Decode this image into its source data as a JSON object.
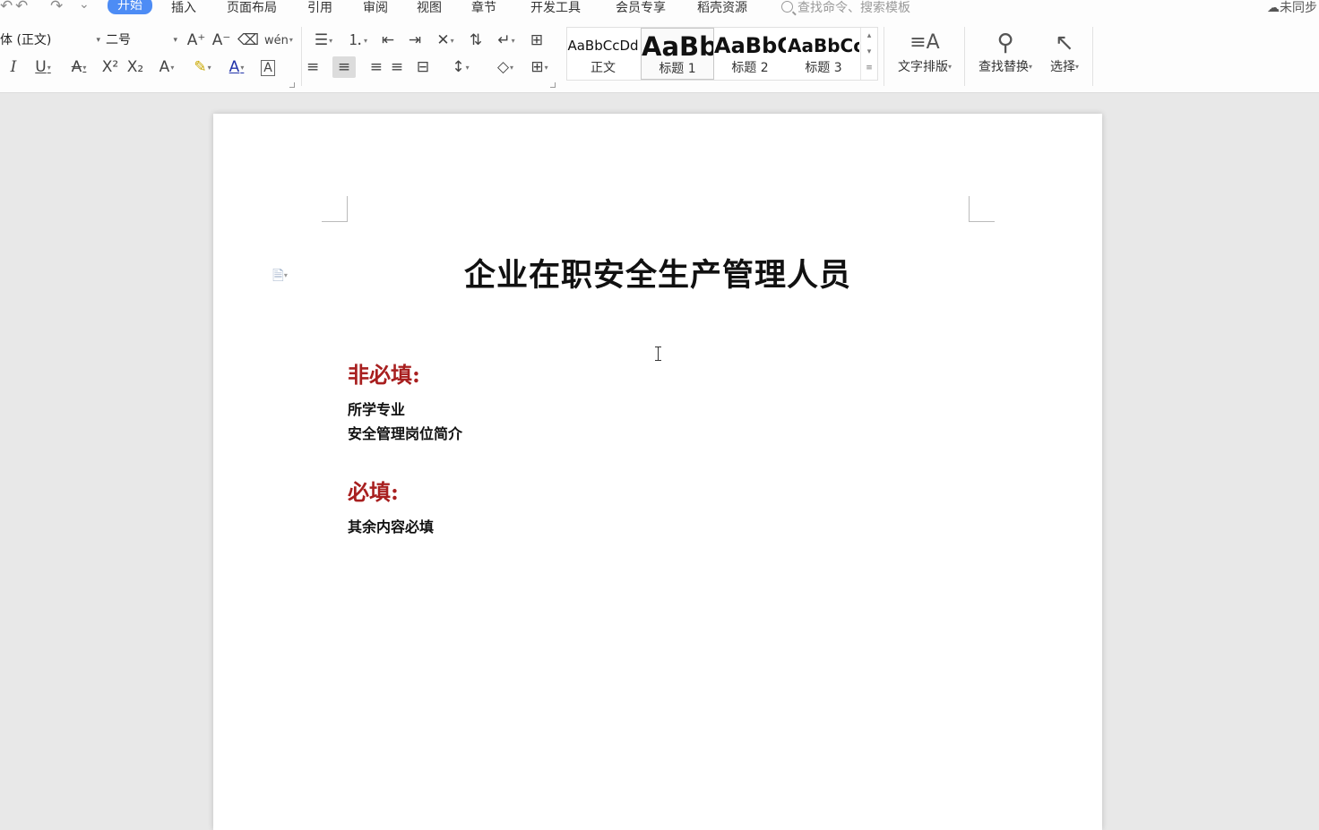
{
  "quick_access": {
    "undo_icon": "↶",
    "redo_icon": "↷",
    "more_icon": "⌄"
  },
  "menus": [
    "开始",
    "插入",
    "页面布局",
    "引用",
    "审阅",
    "视图",
    "章节",
    "开发工具",
    "会员专享",
    "稻壳资源"
  ],
  "active_menu": "开始",
  "search": {
    "placeholder": "查找命令、搜索模板"
  },
  "sync_status": "未同步",
  "font": {
    "name": "体 (正文)",
    "size": "二号"
  },
  "font_tools": {
    "grow": "A⁺",
    "shrink": "A⁻",
    "clear": "⌫",
    "phonetic": "wén",
    "italic": "I",
    "underline": "U",
    "strike": "A",
    "superscript": "X²",
    "subscript": "X₂",
    "effect": "A",
    "highlight": "✎",
    "font_color": "A",
    "char_border": "A"
  },
  "para_tools": {
    "bullets": "☰",
    "numbering": "⒈",
    "outdent": "⇤",
    "indent": "⇥",
    "chinese_layout": "✕",
    "sort": "⇅",
    "show_marks": "↵",
    "table": "⊞",
    "align_left": "≡",
    "align_center": "≡",
    "align_right": "≡",
    "justify": "≡",
    "distribute": "⊟",
    "line_spacing": "↕",
    "shading": "◇",
    "borders": "⊞"
  },
  "styles": [
    {
      "preview": "AaBbCcDd",
      "name": "正文"
    },
    {
      "preview": "AaBb",
      "name": "标题 1"
    },
    {
      "preview": "AaBbC",
      "name": "标题 2"
    },
    {
      "preview": "AaBbCc",
      "name": "标题 3"
    }
  ],
  "big_tools": [
    {
      "icon": "≡A",
      "label": "文字排版"
    },
    {
      "icon": "⚲",
      "label": "查找替换"
    },
    {
      "icon": "↖",
      "label": "选择"
    }
  ],
  "document": {
    "title": "企业在职安全生产管理人员",
    "optional_heading": "非必填:",
    "optional_items": [
      "所学专业",
      "安全管理岗位简介"
    ],
    "required_heading": "必填:",
    "required_items": [
      "其余内容必填"
    ]
  },
  "colors": {
    "accent": "#4d8cf5",
    "heading_red": "#a81f1f"
  }
}
